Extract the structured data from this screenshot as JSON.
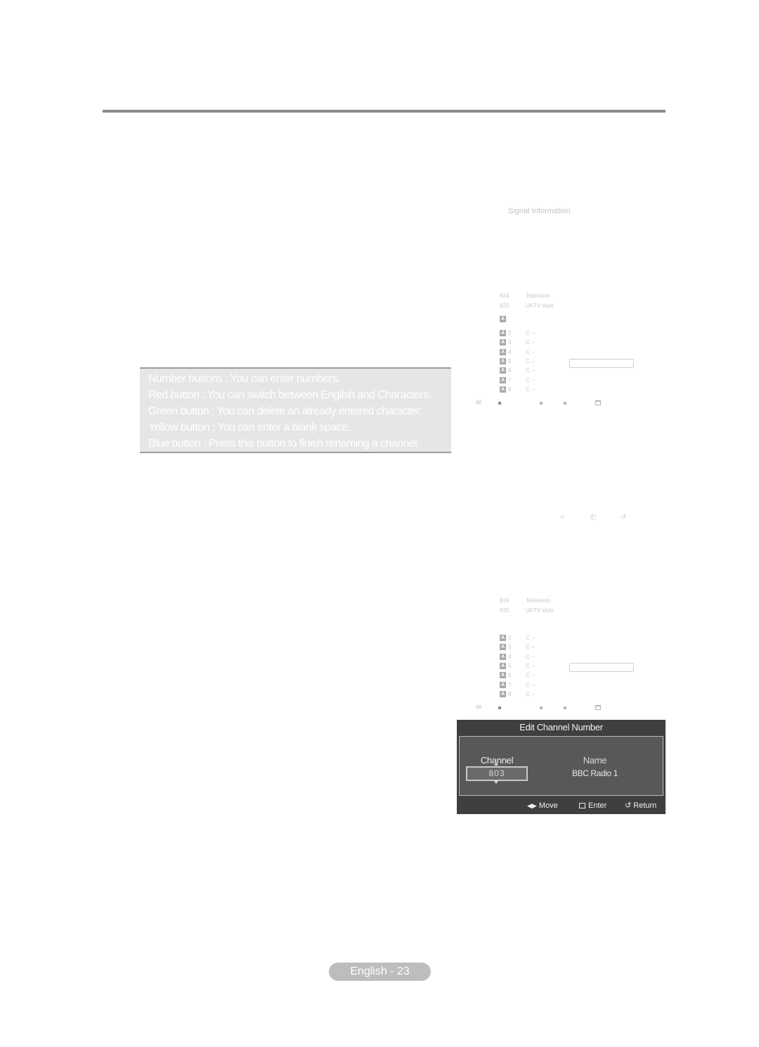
{
  "page": {
    "footer_label": "English - 23"
  },
  "screen1": {
    "menu_item": "Signal Information"
  },
  "notes": {
    "lines": [
      "Number buttons   : You can enter numbers.",
      "Red button  : You can switch between English and Characters.",
      "Green button  : You can delete an already entered character.",
      "Yellow button  : You can enter a blank space.",
      "Blue button  : Press this button to finish renaming a channel."
    ]
  },
  "channel_list_1": {
    "top_rows": [
      {
        "num": "824",
        "name": "Television"
      },
      {
        "num": "825",
        "name": "UKTV style"
      }
    ],
    "badge_letter": "A",
    "analog_rows": [
      {
        "num": "2",
        "name": "C --"
      },
      {
        "num": "3",
        "name": "C --"
      },
      {
        "num": "4",
        "name": "C --"
      },
      {
        "num": "5",
        "name": "C --"
      },
      {
        "num": "6",
        "name": "C --"
      },
      {
        "num": "7",
        "name": "C --"
      },
      {
        "num": "8",
        "name": "C --"
      }
    ],
    "legend_all": "All"
  },
  "nav_icons": [
    "move-icon",
    "enter-icon",
    "return-icon"
  ],
  "channel_list_2": {
    "top_rows": [
      {
        "num": "824",
        "name": "Television"
      },
      {
        "num": "825",
        "name": "UKTV style"
      }
    ],
    "badge_letter": "A",
    "analog_rows": [
      {
        "num": "2",
        "name": "C --"
      },
      {
        "num": "3",
        "name": "C --"
      },
      {
        "num": "4",
        "name": "C --"
      },
      {
        "num": "5",
        "name": "C --"
      },
      {
        "num": "6",
        "name": "C --"
      },
      {
        "num": "7",
        "name": "C --"
      },
      {
        "num": "8",
        "name": "C --"
      }
    ],
    "legend_all": "All"
  },
  "dialog": {
    "title": "Edit Channel Number",
    "channel_label": "Channel",
    "channel_value": "803",
    "name_label": "Name",
    "name_value": "BBC Radio 1",
    "footer": {
      "move": "Move",
      "enter": "Enter",
      "return": "Return"
    }
  }
}
